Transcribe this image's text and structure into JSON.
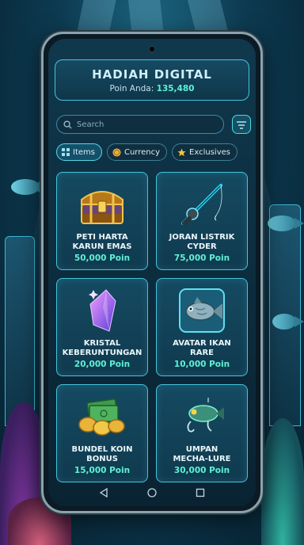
{
  "header": {
    "title": "HADIAH DIGITAL",
    "points_label": "Poin Anda:",
    "points_value": "135,480"
  },
  "search": {
    "placeholder": "Search"
  },
  "tabs": [
    {
      "label": "Items",
      "icon": "grid-icon",
      "active": true
    },
    {
      "label": "Currency",
      "icon": "coin-icon",
      "active": false
    },
    {
      "label": "Exclusives",
      "icon": "star-icon",
      "active": false
    }
  ],
  "rewards": [
    {
      "name_line1": "PETI HARTA",
      "name_line2": "KARUN EMAS",
      "price": "50,000 Poin",
      "icon": "treasure-chest-icon"
    },
    {
      "name_line1": "JORAN LISTRIK",
      "name_line2": "CYDER",
      "price": "75,000 Poin",
      "icon": "fishing-rod-icon"
    },
    {
      "name_line1": "KRISTAL",
      "name_line2": "KEBERUNTUNGAN",
      "price": "20,000 Poin",
      "icon": "crystal-icon"
    },
    {
      "name_line1": "AVATAR IKAN",
      "name_line2": "RARE",
      "price": "10,000 Poin",
      "icon": "fish-avatar-icon"
    },
    {
      "name_line1": "BUNDEL KOIN",
      "name_line2": "BONUS",
      "price": "15,000 Poin",
      "icon": "coin-bundle-icon"
    },
    {
      "name_line1": "UMPAN",
      "name_line2": "MECHA-LURE",
      "price": "30,000 Poin",
      "icon": "fishing-lure-icon"
    }
  ],
  "colors": {
    "accent": "#45c3dc",
    "points": "#5ef2d6",
    "background": "#0c2c3d"
  }
}
